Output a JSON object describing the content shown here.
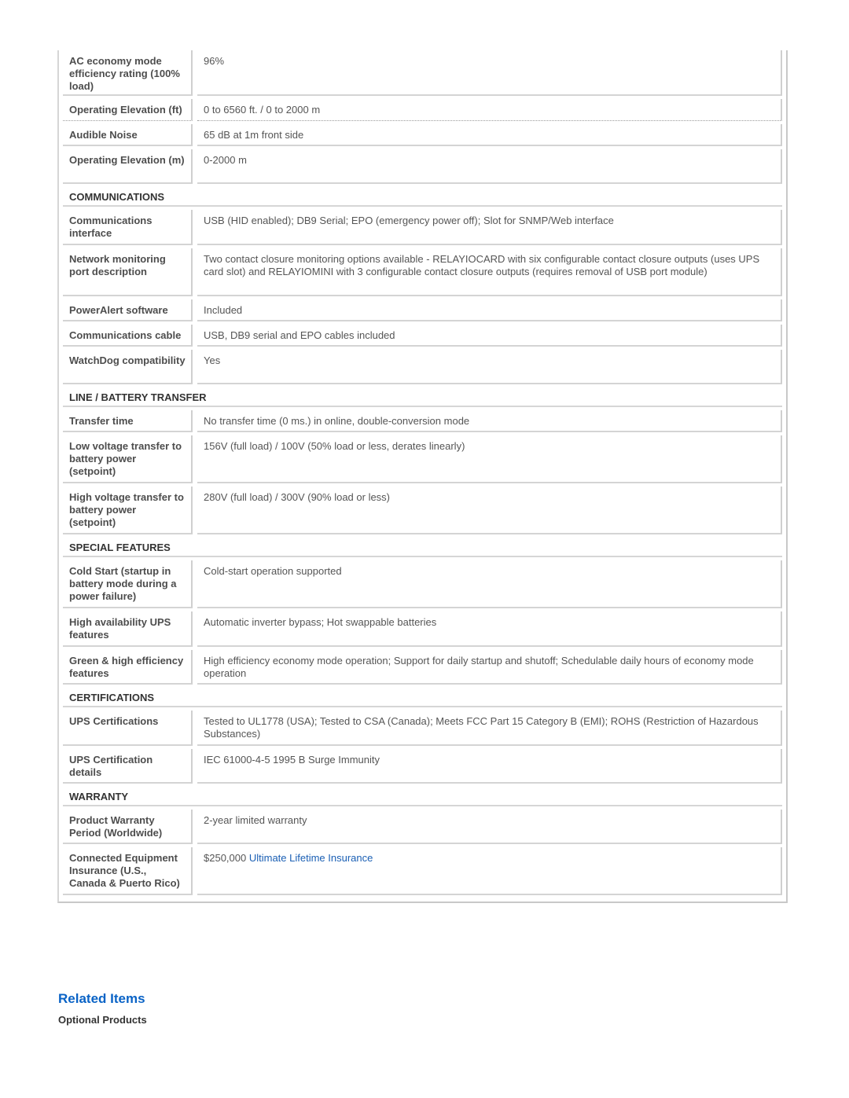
{
  "specs": {
    "rows": [
      {
        "type": "row",
        "label": "AC economy mode efficiency rating (100% load)",
        "value": "96%",
        "h": 62
      },
      {
        "type": "row",
        "label": "Operating Elevation (ft)",
        "value": "0 to 6560 ft. / 0 to 2000 m",
        "h": 32,
        "dotted": true
      },
      {
        "type": "row",
        "label": "Audible Noise",
        "value": "65 dB at 1m front side",
        "h": 32
      },
      {
        "type": "row",
        "label": "Operating Elevation (m)",
        "value": "0-2000 m",
        "h": 48
      },
      {
        "type": "section",
        "title": "COMMUNICATIONS"
      },
      {
        "type": "row",
        "label": "Communications interface",
        "value": "USB (HID enabled); DB9 Serial; EPO (emergency power off); Slot for SNMP/Web interface",
        "h": 49
      },
      {
        "type": "row",
        "label": "Network monitoring port description",
        "value": "Two contact closure monitoring options available - RELAYIOCARD with six configurable contact closure outputs (uses UPS card slot) and RELAYIOMINI with 3 configurable contact closure outputs (requires removal of USB port module)",
        "h": 65
      },
      {
        "type": "row",
        "label": "PowerAlert software",
        "value": "Included",
        "h": 32
      },
      {
        "type": "row",
        "label": "Communications cable",
        "value": "USB, DB9 serial and EPO cables included",
        "h": 32
      },
      {
        "type": "row",
        "label": "WatchDog compatibility",
        "value": "Yes",
        "h": 48
      },
      {
        "type": "section",
        "title": "LINE / BATTERY TRANSFER"
      },
      {
        "type": "row",
        "label": "Transfer time",
        "value": "No transfer time (0 ms.) in online, double-conversion mode",
        "h": 32
      },
      {
        "type": "row",
        "label": "Low voltage transfer to battery power (setpoint)",
        "value": "156V (full load) / 100V (50% load or less, derates linearly)",
        "h": 65
      },
      {
        "type": "row",
        "label": "High voltage transfer to battery power (setpoint)",
        "value": "280V (full load) / 300V (90% load or less)",
        "h": 65
      },
      {
        "type": "section",
        "title": "SPECIAL FEATURES"
      },
      {
        "type": "row",
        "label": "Cold Start (startup in battery mode during a power failure)",
        "value": "Cold-start operation supported",
        "h": 65
      },
      {
        "type": "row",
        "label": "High availability UPS features",
        "value": "Automatic inverter bypass; Hot swappable batteries",
        "h": 49
      },
      {
        "type": "row",
        "label": "Green & high efficiency features",
        "value": "High efficiency economy mode operation; Support for daily startup and shutoff; Schedulable daily hours of economy mode operation",
        "h": 48
      },
      {
        "type": "section",
        "title": "CERTIFICATIONS"
      },
      {
        "type": "row",
        "label": "UPS Certifications",
        "value": "Tested to UL1778 (USA); Tested to CSA (Canada); Meets FCC Part 15 Category B (EMI); ROHS (Restriction of Hazardous Substances)",
        "h": 49
      },
      {
        "type": "row",
        "label": "UPS Certification details",
        "value": "IEC 61000-4-5 1995 B Surge Immunity",
        "h": 48
      },
      {
        "type": "section",
        "title": "WARRANTY"
      },
      {
        "type": "row",
        "label": "Product Warranty Period (Worldwide)",
        "value": "2-year limited warranty",
        "h": 48
      },
      {
        "type": "row",
        "label": "Connected Equipment Insurance (U.S., Canada & Puerto Rico)",
        "value": "$250,000 ",
        "link": "Ultimate Lifetime Insurance",
        "h": 65
      }
    ]
  },
  "related": {
    "title": "Related Items",
    "subtitle": "Optional Products"
  },
  "colors": {
    "link": "#1a5fb4",
    "heading_blue": "#0a63c6"
  }
}
